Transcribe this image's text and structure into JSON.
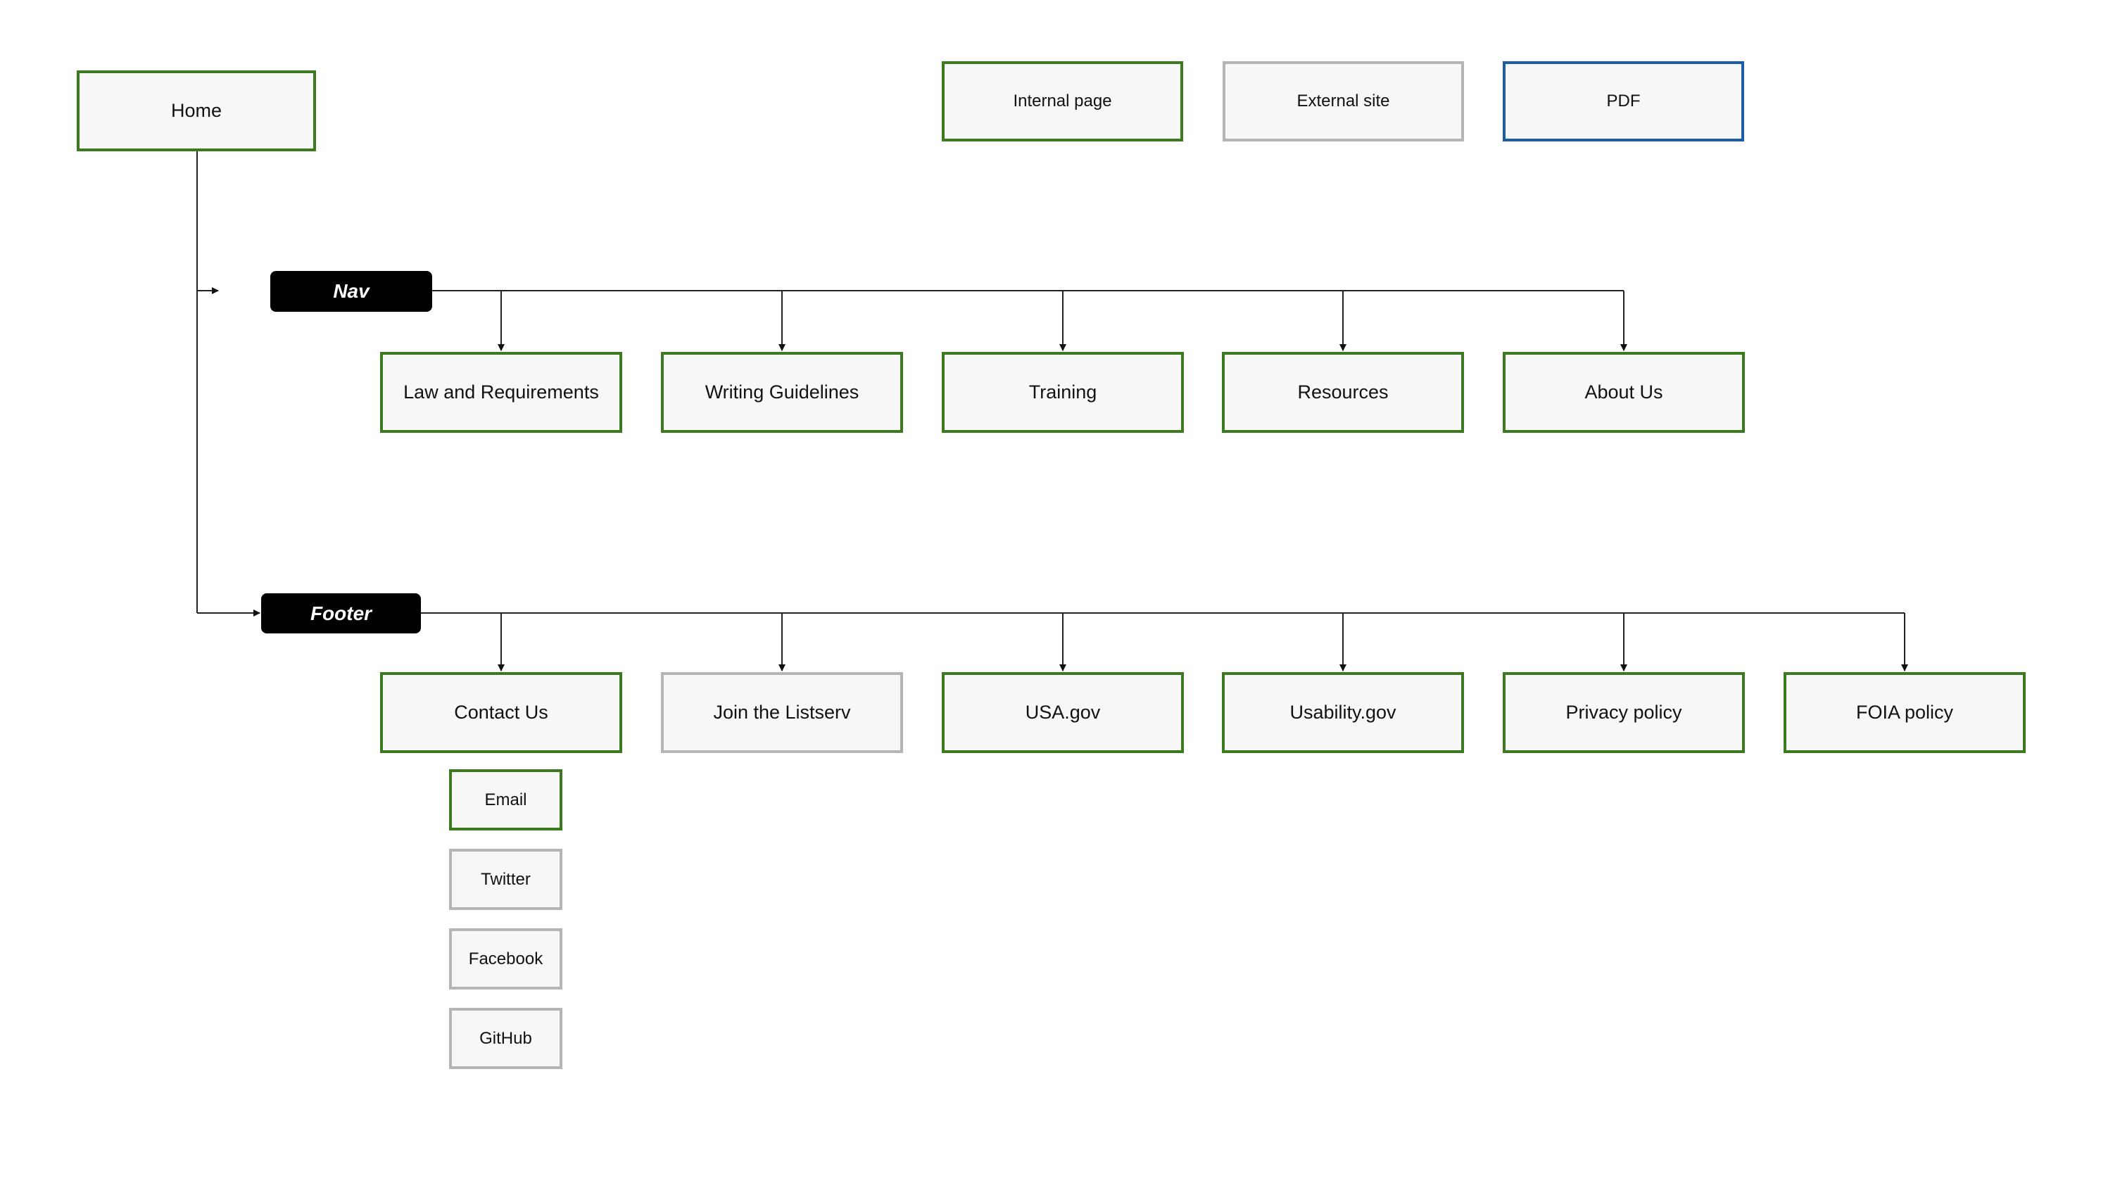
{
  "legend": {
    "internal": "Internal page",
    "external": "External site",
    "pdf": "PDF"
  },
  "colors": {
    "internal": "#3b7a1e",
    "external": "#b5b5b5",
    "pdf": "#1f5ca6",
    "fill": "#f7f7f7"
  },
  "home": "Home",
  "nav": {
    "label": "Nav",
    "items": [
      "Law and Requirements",
      "Writing Guidelines",
      "Training",
      "Resources",
      "About Us"
    ]
  },
  "footer": {
    "label": "Footer",
    "items": [
      "Contact Us",
      "Join the Listserv",
      "USA.gov",
      "Usability.gov",
      "Privacy policy",
      "FOIA policy"
    ],
    "contact_children": [
      "Email",
      "Twitter",
      "Facebook",
      "GitHub"
    ]
  }
}
